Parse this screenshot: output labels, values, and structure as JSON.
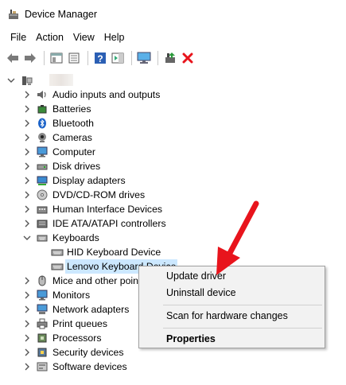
{
  "window": {
    "title": "Device Manager"
  },
  "menu": [
    "File",
    "Action",
    "View",
    "Help"
  ],
  "toolbar_icons": [
    "back-arrow-icon",
    "forward-arrow-icon",
    "show-hide-tree-icon",
    "properties-icon",
    "help-icon",
    "action-pane-icon",
    "computer-monitor-icon",
    "update-driver-icon",
    "uninstall-icon"
  ],
  "tree": {
    "categories": [
      "Audio inputs and outputs",
      "Batteries",
      "Bluetooth",
      "Cameras",
      "Computer",
      "Disk drives",
      "Display adapters",
      "DVD/CD-ROM drives",
      "Human Interface Devices",
      "IDE ATA/ATAPI controllers",
      "Keyboards",
      "HID Keyboard Device",
      "Lenovo Keyboard Device",
      "Mice and other pointing devices",
      "Monitors",
      "Network adapters",
      "Print queues",
      "Processors",
      "Security devices",
      "Software devices"
    ]
  },
  "context_menu": {
    "update": "Update driver",
    "uninstall": "Uninstall device",
    "scan": "Scan for hardware changes",
    "properties": "Properties"
  },
  "colors": {
    "selection": "#cce8ff",
    "accent_red": "#e8141c",
    "help_blue": "#2b5fb4"
  }
}
